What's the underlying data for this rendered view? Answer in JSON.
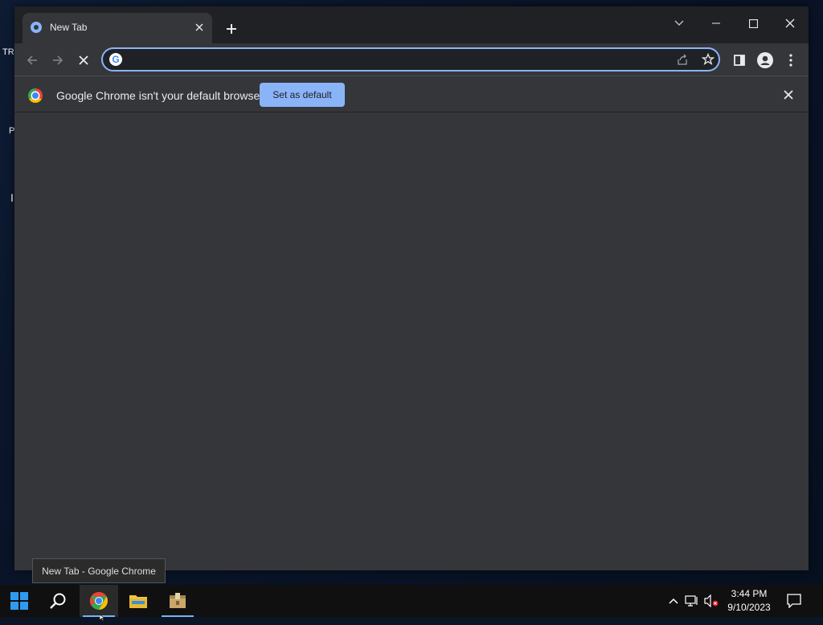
{
  "desktop": {
    "fragments": [
      "TR",
      "P",
      "I"
    ]
  },
  "browser": {
    "tab": {
      "title": "New Tab",
      "favicon": "chrome-newtab-icon"
    },
    "omnibox": {
      "value": "",
      "placeholder": ""
    },
    "infobar": {
      "message": "Google Chrome isn't your default browser",
      "button_label": "Set as default"
    },
    "colors": {
      "accent": "#8ab4f8",
      "frame": "#202124",
      "toolbar": "#35363a"
    }
  },
  "tooltip": {
    "text": "New Tab - Google Chrome"
  },
  "taskbar": {
    "clock_time": "3:44 PM",
    "clock_date": "9/10/2023",
    "apps": [
      "windows-start",
      "search",
      "google-chrome",
      "file-explorer",
      "package-app"
    ]
  }
}
